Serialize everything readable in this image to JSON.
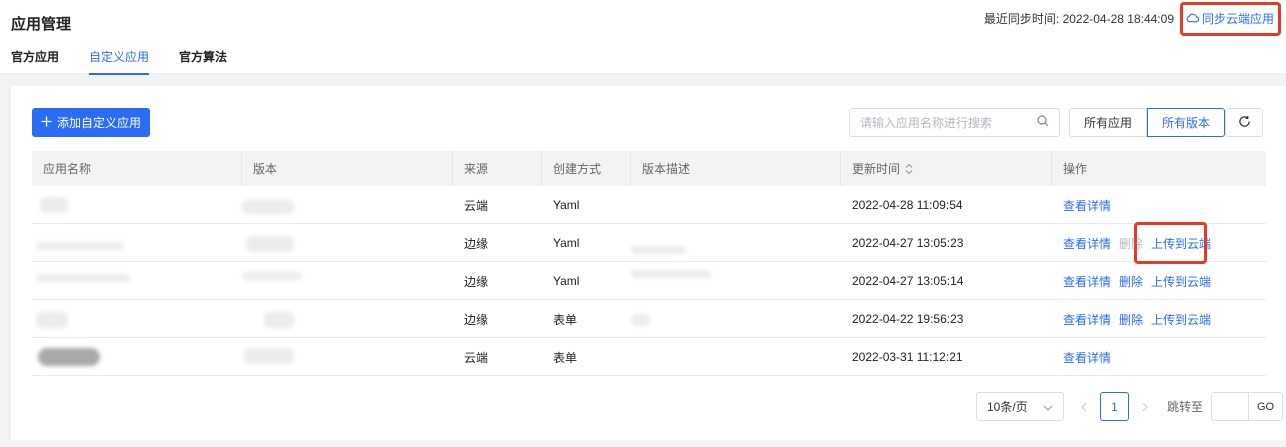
{
  "header": {
    "title": "应用管理",
    "sync_time_label": "最近同步时间:",
    "sync_time_value": "2022-04-28 18:44:09",
    "sync_button": "同步云端应用",
    "sync_icon": "cloud-icon"
  },
  "tabs": [
    {
      "label": "官方应用",
      "active": false
    },
    {
      "label": "自定义应用",
      "active": true
    },
    {
      "label": "官方算法",
      "active": false
    }
  ],
  "toolbar": {
    "add_button": "添加自定义应用",
    "search_placeholder": "请输入应用名称进行搜索",
    "filter_all_apps": "所有应用",
    "filter_all_versions": "所有版本",
    "active_filter": "所有版本"
  },
  "table": {
    "columns": [
      "应用名称",
      "版本",
      "来源",
      "创建方式",
      "版本描述",
      "更新时间",
      "操作"
    ],
    "rows": [
      {
        "source": "云端",
        "method": "Yaml",
        "updated": "2022-04-28 11:09:54",
        "actions": [
          "查看详情"
        ]
      },
      {
        "source": "边缘",
        "method": "Yaml",
        "updated": "2022-04-27 13:05:23",
        "actions": [
          "查看详情",
          "删除",
          "上传到云端"
        ],
        "disabled": [
          "删除"
        ]
      },
      {
        "source": "边缘",
        "method": "Yaml",
        "updated": "2022-04-27 13:05:14",
        "actions": [
          "查看详情",
          "删除",
          "上传到云端"
        ],
        "disabled": []
      },
      {
        "source": "边缘",
        "method": "表单",
        "updated": "2022-04-22 19:56:23",
        "actions": [
          "查看详情",
          "删除",
          "上传到云端"
        ],
        "disabled": []
      },
      {
        "source": "云端",
        "method": "表单",
        "updated": "2022-03-31 11:12:21",
        "actions": [
          "查看详情"
        ]
      }
    ]
  },
  "pagination": {
    "page_size": "10条/页",
    "current_page": "1",
    "jump_label": "跳转至",
    "go_button": "GO"
  },
  "colors": {
    "primary": "#2b6cf5",
    "highlight": "#e53a24"
  }
}
